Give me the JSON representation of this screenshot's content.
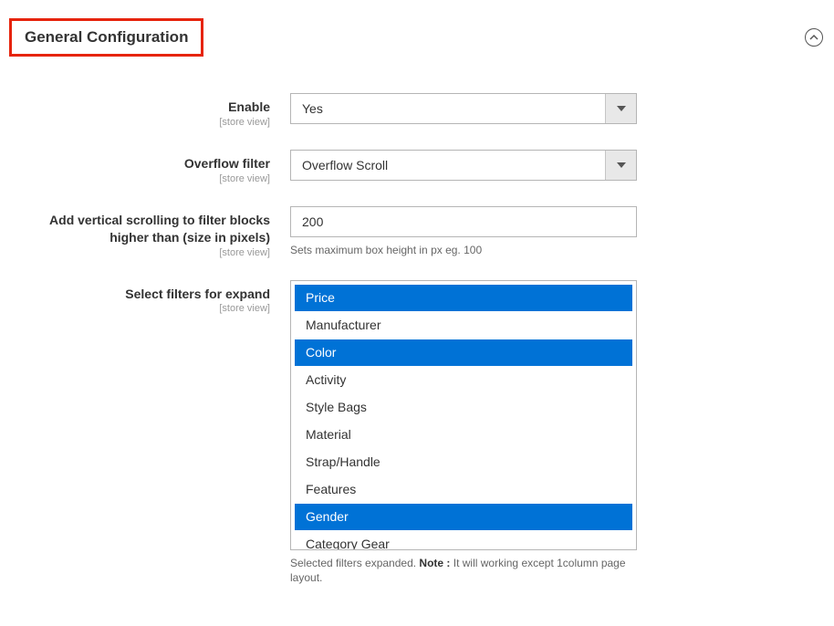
{
  "section": {
    "title": "General Configuration"
  },
  "scope_label": "[store view]",
  "fields": {
    "enable": {
      "label": "Enable",
      "value": "Yes"
    },
    "overflow_filter": {
      "label": "Overflow filter",
      "value": "Overflow Scroll"
    },
    "max_height": {
      "label": "Add vertical scrolling to filter blocks higher than (size in pixels)",
      "value": "200",
      "help": "Sets maximum box height in px eg. 100"
    },
    "filters_expand": {
      "label": "Select filters for expand",
      "options": [
        {
          "label": "Price",
          "selected": true
        },
        {
          "label": "Manufacturer",
          "selected": false
        },
        {
          "label": "Color",
          "selected": true
        },
        {
          "label": "Activity",
          "selected": false
        },
        {
          "label": "Style Bags",
          "selected": false
        },
        {
          "label": "Material",
          "selected": false
        },
        {
          "label": "Strap/Handle",
          "selected": false
        },
        {
          "label": "Features",
          "selected": false
        },
        {
          "label": "Gender",
          "selected": true
        },
        {
          "label": "Category Gear",
          "selected": false
        }
      ],
      "help_prefix": "Selected filters expanded. ",
      "help_note_label": "Note :",
      "help_suffix": " It will working except 1column page layout."
    }
  }
}
